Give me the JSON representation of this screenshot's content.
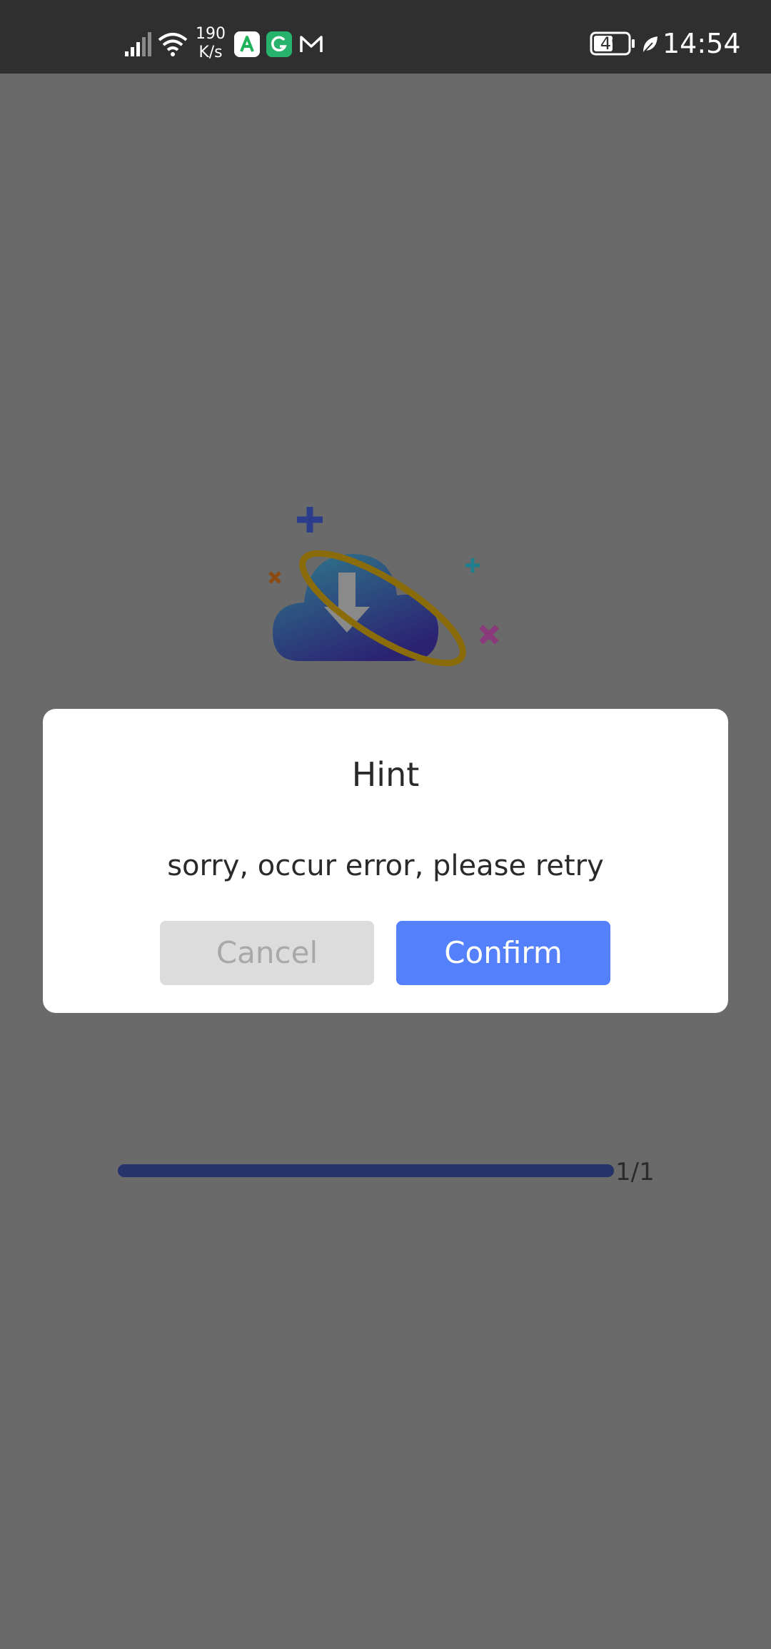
{
  "status_bar": {
    "net_speed_value": "190",
    "net_speed_unit": "K/s",
    "battery": "49",
    "time": "14:54",
    "icons": [
      "signal-icon",
      "wifi-icon",
      "app-a-icon",
      "app-g-icon",
      "mail-icon",
      "battery-icon",
      "leaf-icon"
    ]
  },
  "illustration": {
    "icon": "cloud-download-icon",
    "colors": {
      "cloud_top": "#2f7a8c",
      "cloud_bottom": "#2b2372",
      "ring": "#8a6d0a",
      "arrow": "#8a8a8a"
    }
  },
  "progress": {
    "fraction": 1.0,
    "label": "1/1"
  },
  "dialog": {
    "title": "Hint",
    "message": "sorry, occur error, please retry",
    "cancel_label": "Cancel",
    "confirm_label": "Confirm",
    "colors": {
      "confirm_bg": "#5580fb",
      "cancel_bg": "#dcdcdc"
    }
  }
}
